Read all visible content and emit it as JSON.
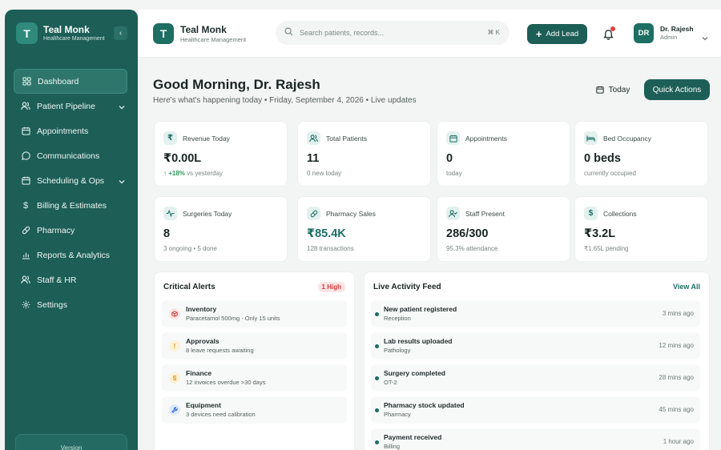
{
  "sidebar": {
    "brand_initial": "T",
    "brand_name": "Teal Monk",
    "brand_sub": "Healthcare Management",
    "collapse_glyph": "‹",
    "items": [
      {
        "label": "Dashboard",
        "icon": "grid-icon",
        "active": true
      },
      {
        "label": "Patient Pipeline",
        "icon": "users-icon",
        "chevron": true
      },
      {
        "label": "Appointments",
        "icon": "calendar-icon"
      },
      {
        "label": "Communications",
        "icon": "chat-icon"
      },
      {
        "label": "Scheduling & Ops",
        "icon": "calendar-check-icon",
        "chevron": true
      },
      {
        "label": "Billing & Estimates",
        "icon": "dollar-icon"
      },
      {
        "label": "Pharmacy",
        "icon": "pill-icon"
      },
      {
        "label": "Reports & Analytics",
        "icon": "chart-icon"
      },
      {
        "label": "Staff & HR",
        "icon": "staff-icon"
      },
      {
        "label": "Settings",
        "icon": "gear-icon"
      }
    ],
    "version_label": "Version"
  },
  "header": {
    "brand_initial": "T",
    "brand_name": "Teal Monk",
    "brand_sub": "Healthcare Management",
    "search_placeholder": "Search patients, records...",
    "search_shortcut": "⌘ K",
    "add_lead_label": "Add Lead",
    "user_initials": "DR",
    "user_name": "Dr. Rajesh",
    "user_role": "Admin"
  },
  "main": {
    "greeting": "Good Morning, Dr. Rajesh",
    "subline": "Here's what's happening today • Friday, September 4, 2026 • Live updates",
    "today_label": "Today",
    "quick_actions_label": "Quick Actions"
  },
  "stats": [
    {
      "label": "Revenue Today",
      "value": "₹0.00L",
      "trend": "↑ +18%",
      "sub": " vs yesterday",
      "icon": "rupee-icon"
    },
    {
      "label": "Total Patients",
      "value": "11",
      "sub": "0 new today",
      "icon": "users-icon"
    },
    {
      "label": "Appointments",
      "value": "0",
      "sub": "today",
      "icon": "calendar-icon"
    },
    {
      "label": "Bed Occupancy",
      "value": "0 beds",
      "sub": "currently occupied",
      "icon": "bed-icon"
    },
    {
      "label": "Surgeries Today",
      "value": "8",
      "sub": "3 ongoing • 5 done",
      "icon": "pulse-icon"
    },
    {
      "label": "Pharmacy Sales",
      "value": "₹85.4K",
      "sub": "128 transactions",
      "icon": "pill-icon"
    },
    {
      "label": "Staff Present",
      "value": "286/300",
      "sub": "95.3% attendance",
      "icon": "user-check-icon"
    },
    {
      "label": "Collections",
      "value": "₹3.2L",
      "sub": "₹1.65L pending",
      "icon": "dollar-icon"
    }
  ],
  "alerts": {
    "title": "Critical Alerts",
    "badge": "1 High",
    "items": [
      {
        "title": "Inventory",
        "desc": "Paracetamol 500mg - Only 15 units",
        "icon": "box-icon",
        "color": "#d23b3b",
        "bg": "#fde4e4"
      },
      {
        "title": "Approvals",
        "desc": "8 leave requests awaiting",
        "icon": "info-icon",
        "color": "#d99a1c",
        "bg": "#fdf1d6"
      },
      {
        "title": "Finance",
        "desc": "12 invoices overdue >30 days",
        "icon": "dollar-icon",
        "color": "#d99a1c",
        "bg": "#fdf1d6"
      },
      {
        "title": "Equipment",
        "desc": "3 devices need calibration",
        "icon": "wrench-icon",
        "color": "#3a6fd8",
        "bg": "#e2ebfc"
      }
    ]
  },
  "activity": {
    "title": "Live Activity Feed",
    "view_all": "View All",
    "items": [
      {
        "title": "New patient registered",
        "sub": "Reception",
        "time": "3 mins ago"
      },
      {
        "title": "Lab results uploaded",
        "sub": "Pathology",
        "time": "12 mins ago"
      },
      {
        "title": "Surgery completed",
        "sub": "OT-2",
        "time": "28 mins ago"
      },
      {
        "title": "Pharmacy stock updated",
        "sub": "Pharmacy",
        "time": "45 mins ago"
      },
      {
        "title": "Payment received",
        "sub": "Billing",
        "time": "1 hour ago"
      }
    ]
  },
  "colors": {
    "primary": "#1d5e57",
    "accent": "#1d6e63",
    "danger": "#d23b3b"
  }
}
